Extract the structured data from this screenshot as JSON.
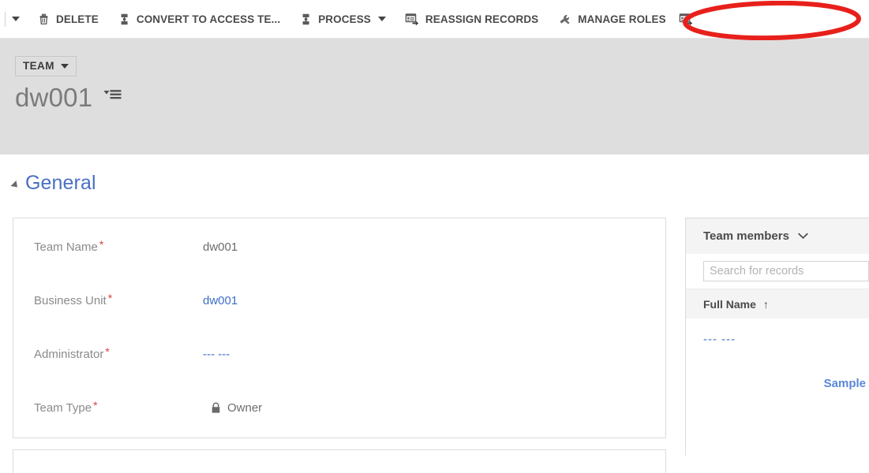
{
  "command_bar": {
    "overflow_caret_name": "chevron-down-icon",
    "buttons": [
      {
        "label": "DELETE",
        "icon": "trash-icon",
        "has_caret": false
      },
      {
        "label": "CONVERT TO ACCESS TE...",
        "icon": "hierarchy-icon",
        "has_caret": false
      },
      {
        "label": "PROCESS",
        "icon": "hierarchy-icon",
        "has_caret": true
      },
      {
        "label": "REASSIGN RECORDS",
        "icon": "reassign-records-icon",
        "has_caret": false
      },
      {
        "label": "MANAGE ROLES",
        "icon": "wrench-icon",
        "has_caret": false
      }
    ],
    "trailing_icon": "reassign-records-icon"
  },
  "record_header": {
    "entity_chip": "TEAM",
    "entity_chip_caret": "chevron-down-icon",
    "title": "dw001",
    "title_menu_icon": "record-set-menu-icon"
  },
  "form": {
    "section": {
      "title": "General",
      "collapse_icon": "triangle-collapse-icon"
    },
    "fields": [
      {
        "label": "Team Name",
        "required": "*",
        "value": "dw001",
        "style": "plain",
        "icon": ""
      },
      {
        "label": "Business Unit",
        "required": "*",
        "value": "dw001",
        "style": "link",
        "icon": ""
      },
      {
        "label": "Administrator",
        "required": "*",
        "value": "--- ---",
        "style": "link",
        "icon": ""
      },
      {
        "label": "Team Type",
        "required": "*",
        "value": "Owner",
        "style": "plain",
        "icon": "lock-icon"
      }
    ]
  },
  "related_panel": {
    "title": "Team members",
    "collapse_icon": "chevron-down-icon",
    "search": {
      "value": "",
      "placeholder": "Search for records"
    },
    "grid": {
      "columns": [
        {
          "label": "Full Name",
          "sort": "↑"
        }
      ],
      "rows": [
        {
          "full_name": "--- ---"
        }
      ]
    },
    "footer_link": "Sample"
  },
  "annotation": {
    "shape": "ellipse",
    "color": "#e8201b",
    "target": "MANAGE ROLES"
  },
  "colors": {
    "header_band": "#dededf",
    "section_title": "#4a6fc1",
    "link": "#3f6fc4",
    "required_star": "#d64040",
    "annotation_red": "#e8201b",
    "panel_header_bg": "#f4f4f4"
  }
}
